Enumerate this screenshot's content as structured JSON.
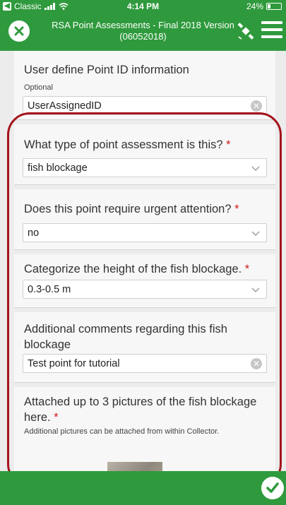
{
  "status_bar": {
    "carrier": "Classic",
    "time": "4:14 PM",
    "battery": "24%",
    "battery_level": 0.24
  },
  "header": {
    "title": "RSA Point Assessments - Final 2018 Version (06052018)"
  },
  "form": {
    "user_id": {
      "label": "User define Point ID information",
      "hint": "Optional",
      "value": "UserAssignedID"
    },
    "assessment_type": {
      "label": "What type of point assessment is this?",
      "required_mark": "*",
      "value": "fish blockage"
    },
    "urgent": {
      "label": "Does this point require urgent attention?",
      "required_mark": "*",
      "value": "no"
    },
    "height": {
      "label": "Categorize the height of the fish blockage.",
      "required_mark": "*",
      "value": "0.3-0.5 m"
    },
    "comments": {
      "label": "Additional comments regarding this fish blockage",
      "value": "Test point for tutorial"
    },
    "pictures": {
      "label": "Attached up to 3 pictures of the fish blockage here.",
      "required_mark": "*",
      "hint": "Additional pictures can be attached from within Collector."
    }
  },
  "icons": {
    "close": "close-icon",
    "gps": "satellite-icon",
    "menu": "hamburger-menu-icon",
    "clear": "clear-icon",
    "dropdown": "chevron-down-icon",
    "submit": "checkmark-icon"
  },
  "colors": {
    "brand_green": "#2f9a3d",
    "highlight_red": "#a5131d",
    "required_red": "#d21a1a"
  }
}
